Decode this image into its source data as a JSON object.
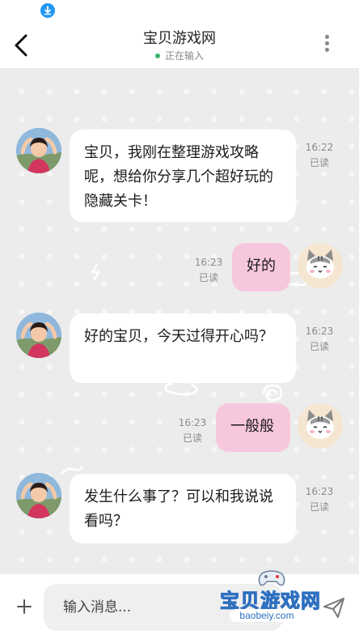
{
  "header": {
    "title": "宝贝游戏网",
    "status": "正在输入"
  },
  "messages": [
    {
      "side": "in",
      "text": "宝贝，我刚在整理游戏攻略呢，想给你分享几个超好玩的隐藏关卡！",
      "time": "16:22",
      "read": "已读"
    },
    {
      "side": "out",
      "text": "好的",
      "time": "16:23",
      "read": "已读"
    },
    {
      "side": "in",
      "text": "好的宝贝，今天过得开心吗？",
      "time": "16:23",
      "read": "已读"
    },
    {
      "side": "out",
      "text": "一般般",
      "time": "16:23",
      "read": "已读"
    },
    {
      "side": "in",
      "text": "发生什么事了？可以和我说说看吗？",
      "time": "16:23",
      "read": "已读"
    }
  ],
  "composer": {
    "placeholder": "输入消息..."
  },
  "watermark": {
    "text": "宝贝游戏网",
    "url": "baobeiy.com"
  },
  "icons": {
    "download": "download-icon",
    "back": "back-arrow-icon",
    "more": "more-vertical-icon",
    "plus": "plus-icon",
    "send": "paper-plane-icon"
  },
  "colors": {
    "chat_background": "#ececec",
    "incoming_bubble": "#ffffff",
    "outgoing_bubble": "#f7c7de",
    "online_dot": "#3cb371"
  }
}
